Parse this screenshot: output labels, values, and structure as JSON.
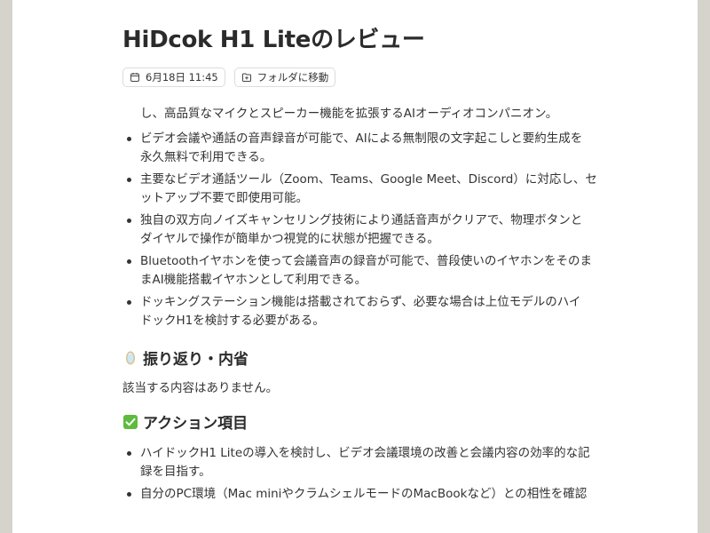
{
  "note": {
    "title": "HiDcok H1 Liteのレビュー",
    "date_chip": "6月18日 11:45",
    "folder_chip": "フォルダに移動",
    "continuation_line": "し、高品質なマイクとスピーカー機能を拡張するAIオーディオコンパニオン。",
    "bullets": [
      [
        "ビデオ会議や通話の音声録音が可能で、AIによる無制限の文字起こしと要約生成を",
        "永久無料で利用できる。"
      ],
      [
        "主要なビデオ通話ツール（Zoom、Teams、Google Meet、Discord）に対応し、セ",
        "ットアップ不要で即使用可能。"
      ],
      [
        "独自の双方向ノイズキャンセリング技術により通話音声がクリアで、物理ボタンと",
        "ダイヤルで操作が簡単かつ視覚的に状態が把握できる。"
      ],
      [
        "Bluetoothイヤホンを使って会議音声の録音が可能で、普段使いのイヤホンをそのま",
        "まAI機能搭載イヤホンとして利用できる。"
      ],
      [
        "ドッキングステーション機能は搭載されておらず、必要な場合は上位モデルのハイ",
        "ドックH1を検討する必要がある。"
      ]
    ],
    "reflection_heading": "振り返り・内省",
    "reflection_text": "該当する内容はありません。",
    "action_heading": "アクション項目",
    "action_bullets": [
      [
        "ハイドックH1 Liteの導入を検討し、ビデオ会議環境の改善と会議内容の効率的な記",
        "録を目指す。"
      ],
      [
        "自分のPC環境（Mac miniやクラムシェルモードのMacBookなど）との相性を確認"
      ]
    ]
  },
  "icons": {
    "date": "calendar-icon",
    "folder": "folder-move-icon",
    "reflection": "mirror-icon",
    "action": "check-box-icon"
  },
  "colors": {
    "text": "#333333",
    "check_green": "#5dbb3f",
    "mirror_frame": "#d8c08a",
    "mirror_glass": "#cfe6f5"
  }
}
